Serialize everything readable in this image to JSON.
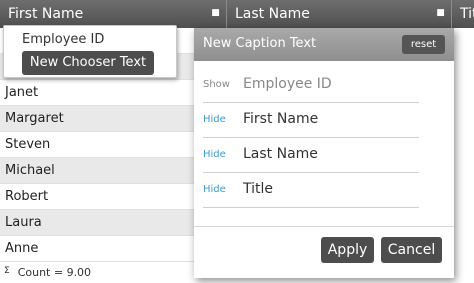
{
  "grid": {
    "columns": [
      {
        "label": "First Name",
        "icon": "column-menu-icon"
      },
      {
        "label": "Last Name",
        "icon": "column-menu-icon"
      },
      {
        "label": "Tit",
        "icon": "column-menu-icon"
      }
    ],
    "rows": [
      "",
      "",
      "Janet",
      "Margaret",
      "Steven",
      "Michael",
      "Robert",
      "Laura",
      "Anne"
    ],
    "footer": {
      "symbol": "Σ",
      "text": "Count = 9.00"
    }
  },
  "chooser": {
    "item": "Employee ID",
    "button": "New Chooser Text"
  },
  "panel": {
    "title": "New Caption Text",
    "reset": "reset",
    "items": [
      {
        "toggle": "Show",
        "name": "Employee ID"
      },
      {
        "toggle": "Hide",
        "name": "First Name"
      },
      {
        "toggle": "Hide",
        "name": "Last Name"
      },
      {
        "toggle": "Hide",
        "name": "Title"
      }
    ],
    "apply": "Apply",
    "cancel": "Cancel"
  },
  "colors": {
    "header": "#5f5f5f",
    "link": "#3a9bd6",
    "button": "#4d4d4d"
  }
}
